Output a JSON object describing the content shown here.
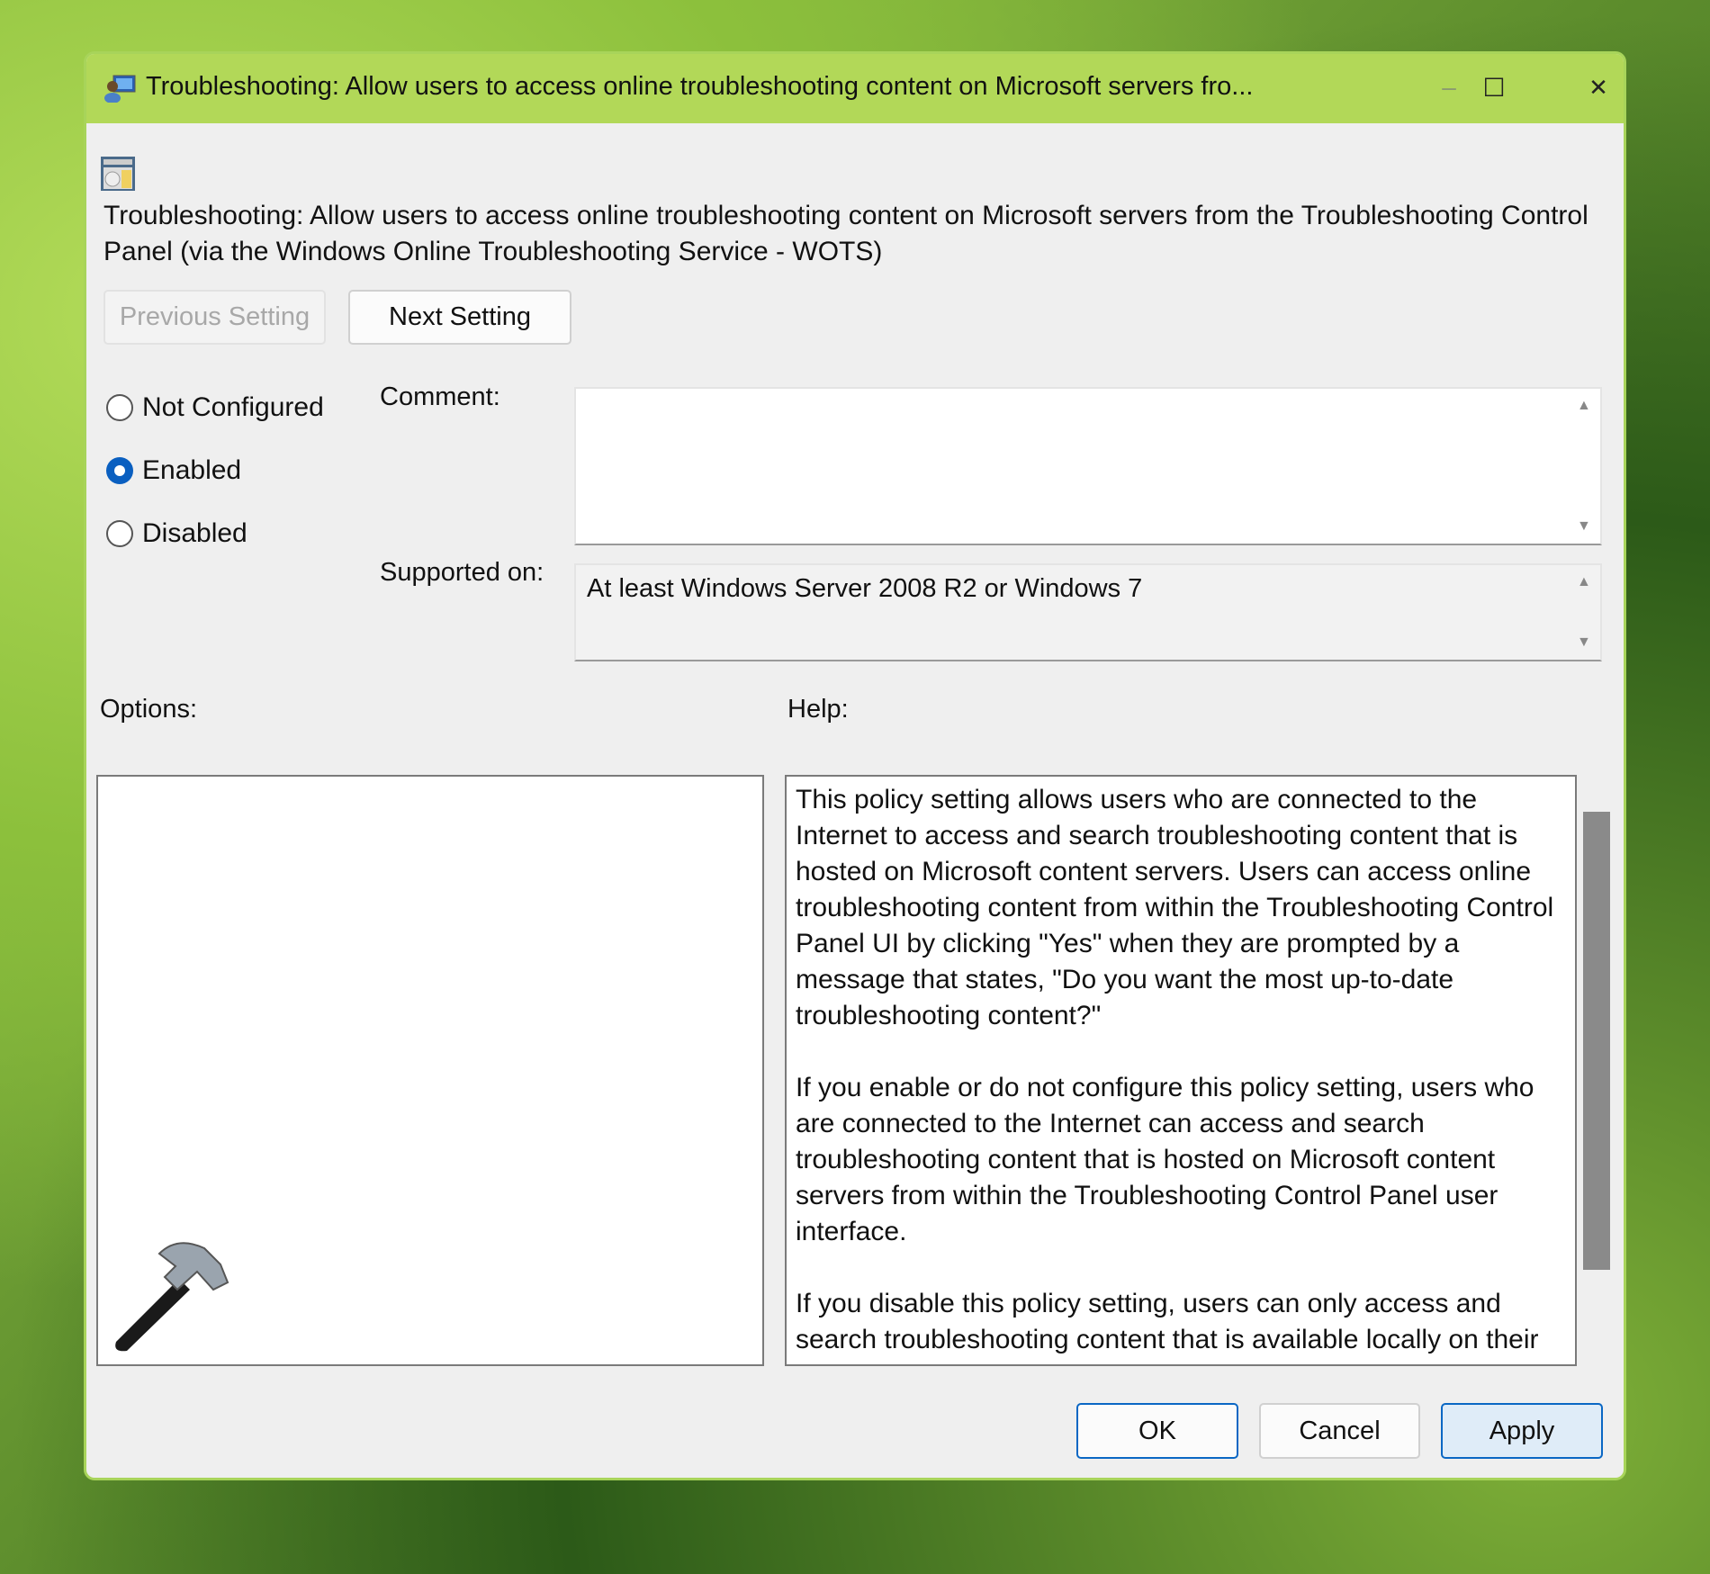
{
  "window": {
    "title": "Troubleshooting: Allow users to access online troubleshooting content on Microsoft servers fro...",
    "minimize": "–",
    "maximize": "☐",
    "close": "✕"
  },
  "heading": "Troubleshooting: Allow users to access online troubleshooting content on Microsoft servers from the Troubleshooting Control Panel (via the Windows Online Troubleshooting Service - WOTS)",
  "nav": {
    "previous": "Previous Setting",
    "next": "Next Setting"
  },
  "state": {
    "options": [
      "Not Configured",
      "Enabled",
      "Disabled"
    ],
    "selected": "Enabled"
  },
  "comment": {
    "label": "Comment:",
    "value": ""
  },
  "supported": {
    "label": "Supported on:",
    "value": "At least Windows Server 2008 R2 or Windows 7"
  },
  "options_label": "Options:",
  "help_label": "Help:",
  "help": [
    "This policy setting allows users who are connected to the Internet to access and search troubleshooting content that is hosted on Microsoft content servers. Users can access online troubleshooting content from within the Troubleshooting Control Panel UI by clicking \"Yes\" when they are prompted by a message that states, \"Do you want the most up-to-date troubleshooting content?\"",
    "If you enable or do not configure this policy setting, users who are connected to the Internet can access and search troubleshooting content that is hosted on Microsoft content servers from within the Troubleshooting Control Panel user interface.",
    "If you disable this policy setting, users can only access and search troubleshooting content that is available locally on their computers, even if they are connected to the Internet. They are prevented from connecting to the Microsoft servers that host the Windows Online"
  ],
  "footer": {
    "ok": "OK",
    "cancel": "Cancel",
    "apply": "Apply"
  },
  "colors": {
    "titlebar": "#b2d858",
    "accent": "#0a5fc0"
  }
}
